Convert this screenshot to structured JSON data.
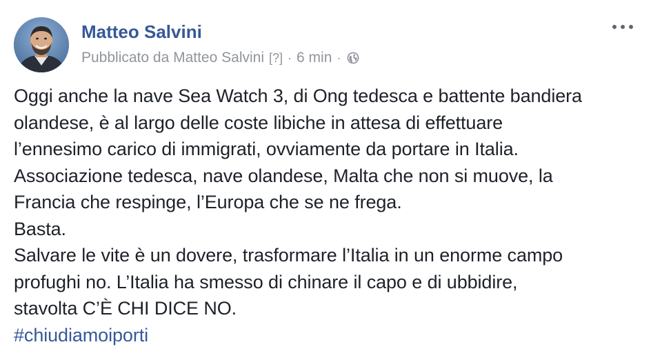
{
  "post": {
    "author": "Matteo Salvini",
    "meta": {
      "published_by": "Pubblicato da Matteo Salvini",
      "qmark": "[?]",
      "separator": "·",
      "time": "6 min",
      "privacy_icon": "globe-icon"
    },
    "more_icon": "more-options-icon",
    "text_lines": [
      "Oggi anche la nave Sea Watch 3, di Ong tedesca e battente bandiera",
      "olandese, è al largo delle coste libiche in attesa di effettuare",
      "l’ennesimo carico di immigrati, ovviamente da portare in Italia.",
      "Associazione tedesca, nave olandese, Malta che non si muove, la",
      "Francia che respinge, l’Europa che se ne frega.",
      "Basta.",
      "Salvare le vite è un dovere, trasformare l’Italia in un enorme campo",
      "profughi no. L’Italia ha smesso di chinare il capo e di ubbidire,",
      "stavolta C’È CHI DICE NO."
    ],
    "hashtag": "#chiudiamoiporti"
  },
  "colors": {
    "link": "#365899",
    "meta_text": "#90949c",
    "body_text": "#1d2129"
  }
}
